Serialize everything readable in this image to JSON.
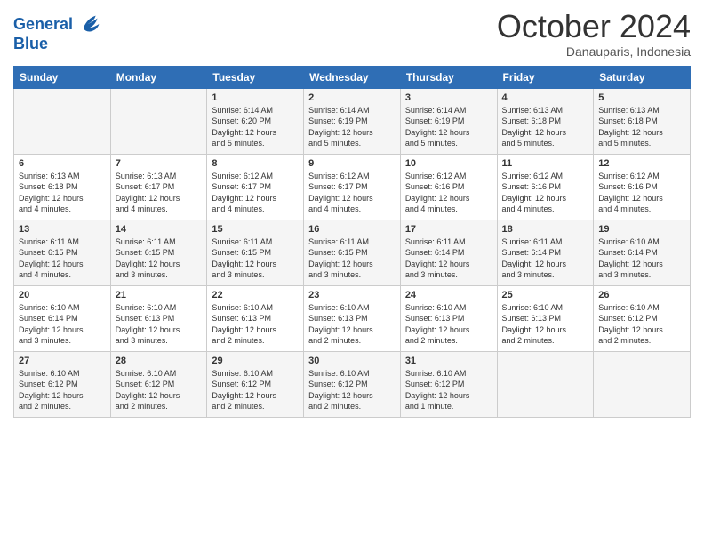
{
  "logo": {
    "line1": "General",
    "line2": "Blue"
  },
  "title": "October 2024",
  "location": "Danauparis, Indonesia",
  "weekdays": [
    "Sunday",
    "Monday",
    "Tuesday",
    "Wednesday",
    "Thursday",
    "Friday",
    "Saturday"
  ],
  "weeks": [
    [
      {
        "day": "",
        "info": ""
      },
      {
        "day": "",
        "info": ""
      },
      {
        "day": "1",
        "info": "Sunrise: 6:14 AM\nSunset: 6:20 PM\nDaylight: 12 hours\nand 5 minutes."
      },
      {
        "day": "2",
        "info": "Sunrise: 6:14 AM\nSunset: 6:19 PM\nDaylight: 12 hours\nand 5 minutes."
      },
      {
        "day": "3",
        "info": "Sunrise: 6:14 AM\nSunset: 6:19 PM\nDaylight: 12 hours\nand 5 minutes."
      },
      {
        "day": "4",
        "info": "Sunrise: 6:13 AM\nSunset: 6:18 PM\nDaylight: 12 hours\nand 5 minutes."
      },
      {
        "day": "5",
        "info": "Sunrise: 6:13 AM\nSunset: 6:18 PM\nDaylight: 12 hours\nand 5 minutes."
      }
    ],
    [
      {
        "day": "6",
        "info": "Sunrise: 6:13 AM\nSunset: 6:18 PM\nDaylight: 12 hours\nand 4 minutes."
      },
      {
        "day": "7",
        "info": "Sunrise: 6:13 AM\nSunset: 6:17 PM\nDaylight: 12 hours\nand 4 minutes."
      },
      {
        "day": "8",
        "info": "Sunrise: 6:12 AM\nSunset: 6:17 PM\nDaylight: 12 hours\nand 4 minutes."
      },
      {
        "day": "9",
        "info": "Sunrise: 6:12 AM\nSunset: 6:17 PM\nDaylight: 12 hours\nand 4 minutes."
      },
      {
        "day": "10",
        "info": "Sunrise: 6:12 AM\nSunset: 6:16 PM\nDaylight: 12 hours\nand 4 minutes."
      },
      {
        "day": "11",
        "info": "Sunrise: 6:12 AM\nSunset: 6:16 PM\nDaylight: 12 hours\nand 4 minutes."
      },
      {
        "day": "12",
        "info": "Sunrise: 6:12 AM\nSunset: 6:16 PM\nDaylight: 12 hours\nand 4 minutes."
      }
    ],
    [
      {
        "day": "13",
        "info": "Sunrise: 6:11 AM\nSunset: 6:15 PM\nDaylight: 12 hours\nand 4 minutes."
      },
      {
        "day": "14",
        "info": "Sunrise: 6:11 AM\nSunset: 6:15 PM\nDaylight: 12 hours\nand 3 minutes."
      },
      {
        "day": "15",
        "info": "Sunrise: 6:11 AM\nSunset: 6:15 PM\nDaylight: 12 hours\nand 3 minutes."
      },
      {
        "day": "16",
        "info": "Sunrise: 6:11 AM\nSunset: 6:15 PM\nDaylight: 12 hours\nand 3 minutes."
      },
      {
        "day": "17",
        "info": "Sunrise: 6:11 AM\nSunset: 6:14 PM\nDaylight: 12 hours\nand 3 minutes."
      },
      {
        "day": "18",
        "info": "Sunrise: 6:11 AM\nSunset: 6:14 PM\nDaylight: 12 hours\nand 3 minutes."
      },
      {
        "day": "19",
        "info": "Sunrise: 6:10 AM\nSunset: 6:14 PM\nDaylight: 12 hours\nand 3 minutes."
      }
    ],
    [
      {
        "day": "20",
        "info": "Sunrise: 6:10 AM\nSunset: 6:14 PM\nDaylight: 12 hours\nand 3 minutes."
      },
      {
        "day": "21",
        "info": "Sunrise: 6:10 AM\nSunset: 6:13 PM\nDaylight: 12 hours\nand 3 minutes."
      },
      {
        "day": "22",
        "info": "Sunrise: 6:10 AM\nSunset: 6:13 PM\nDaylight: 12 hours\nand 2 minutes."
      },
      {
        "day": "23",
        "info": "Sunrise: 6:10 AM\nSunset: 6:13 PM\nDaylight: 12 hours\nand 2 minutes."
      },
      {
        "day": "24",
        "info": "Sunrise: 6:10 AM\nSunset: 6:13 PM\nDaylight: 12 hours\nand 2 minutes."
      },
      {
        "day": "25",
        "info": "Sunrise: 6:10 AM\nSunset: 6:13 PM\nDaylight: 12 hours\nand 2 minutes."
      },
      {
        "day": "26",
        "info": "Sunrise: 6:10 AM\nSunset: 6:12 PM\nDaylight: 12 hours\nand 2 minutes."
      }
    ],
    [
      {
        "day": "27",
        "info": "Sunrise: 6:10 AM\nSunset: 6:12 PM\nDaylight: 12 hours\nand 2 minutes."
      },
      {
        "day": "28",
        "info": "Sunrise: 6:10 AM\nSunset: 6:12 PM\nDaylight: 12 hours\nand 2 minutes."
      },
      {
        "day": "29",
        "info": "Sunrise: 6:10 AM\nSunset: 6:12 PM\nDaylight: 12 hours\nand 2 minutes."
      },
      {
        "day": "30",
        "info": "Sunrise: 6:10 AM\nSunset: 6:12 PM\nDaylight: 12 hours\nand 2 minutes."
      },
      {
        "day": "31",
        "info": "Sunrise: 6:10 AM\nSunset: 6:12 PM\nDaylight: 12 hours\nand 1 minute."
      },
      {
        "day": "",
        "info": ""
      },
      {
        "day": "",
        "info": ""
      }
    ]
  ]
}
